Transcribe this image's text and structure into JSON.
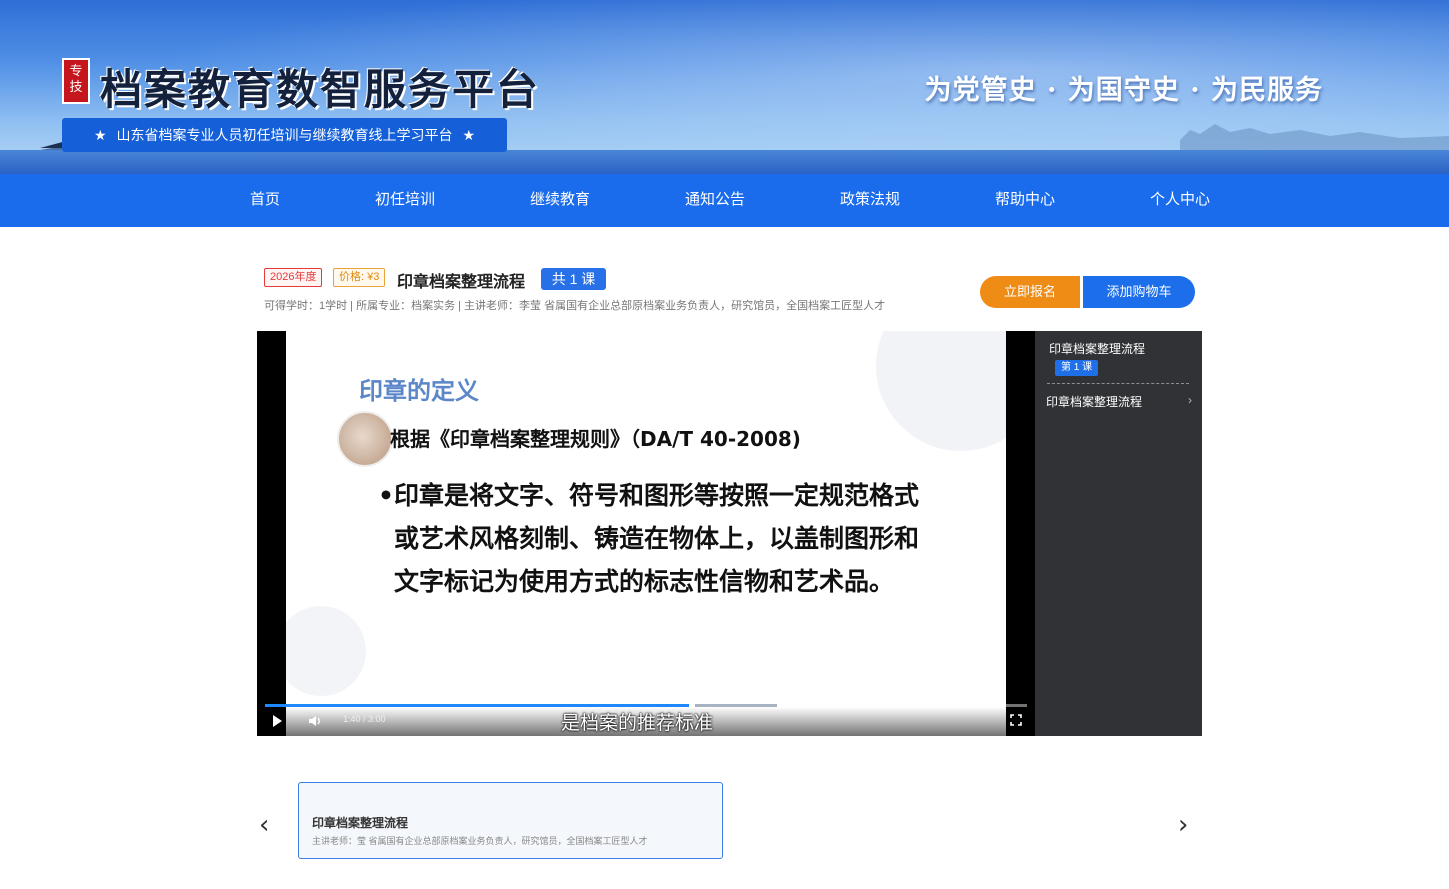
{
  "header": {
    "seal_text": "专技",
    "site_title": "档案教育数智服务平台",
    "subtitle": "山东省档案专业人员初任培训与继续教育线上学习平台",
    "subtitle_star": "★",
    "slogan": "为党管史 · 为国守史 · 为民服务"
  },
  "nav": {
    "items": [
      "首页",
      "初任培训",
      "继续教育",
      "通知公告",
      "政策法规",
      "帮助中心",
      "个人中心"
    ]
  },
  "course": {
    "year_tag": "2026年度",
    "price_tag": "价格: ¥3",
    "title": "印章档案整理流程",
    "lesson_count": "共 1 课",
    "meta": "可得学时：1学时 | 所属专业：档案实务 | 主讲老师：李莹 省属国有企业总部原档案业务负责人，研究馆员，全国档案工匠型人才",
    "enroll_label": "立即报名",
    "cart_label": "添加购物车"
  },
  "player": {
    "slide_heading": "印章的定义",
    "slide_reference": "根据《印章档案整理规则》（DA/T 40-2008)",
    "slide_bullet": "•",
    "slide_body": "印章是将文字、符号和图形等按照一定规范格式或艺术风格刻制、铸造在物体上，以盖制图形和文字标记为使用方式的标志性信物和艺术品。",
    "time": "1:40 / 3:00",
    "progress": 0.556,
    "caption": "是档案的推荐标准"
  },
  "playlist": {
    "title": "印章档案整理流程",
    "lesson_badge": "第 1 课",
    "item_label": "印章档案整理流程",
    "item_chevron": "›"
  },
  "carousel": {
    "prev": "‹",
    "next": "›",
    "card_title": "印章档案整理流程",
    "card_sub": "主讲老师：莹 省属国有企业总部原档案业务负责人，研究馆员，全国档案工匠型人才"
  },
  "colors": {
    "nav_bg": "#1a6cec",
    "enroll": "#ef8c16",
    "cart": "#1c6eea",
    "progress": "#1e88ff"
  }
}
